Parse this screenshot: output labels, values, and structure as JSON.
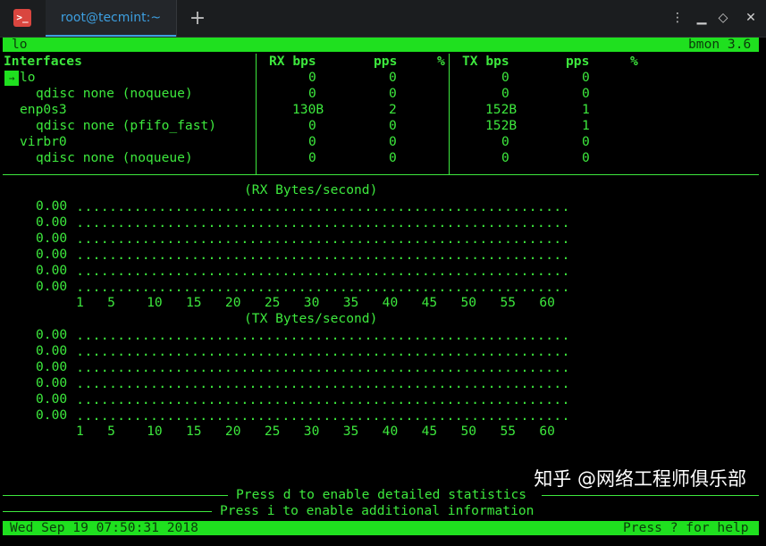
{
  "titlebar": {
    "app_icon": ">_",
    "tab_label": "root@tecmint:~",
    "new_tab": "+",
    "controls": {
      "menu": "⋮",
      "minimize": "▁",
      "restore": "◇",
      "maximize": "▢",
      "close": "✕"
    }
  },
  "top_bar": {
    "left": "lo",
    "right": "bmon 3.6"
  },
  "table": {
    "headers": {
      "interfaces": "Interfaces",
      "rx_bps": "RX bps",
      "rx_pps": "pps",
      "rx_pct": "%",
      "tx_bps": "TX bps",
      "tx_pps": "pps",
      "tx_pct": "%"
    },
    "rows": [
      {
        "name": "lo",
        "rx_bps": "0",
        "rx_pps": "0",
        "tx_bps": "0",
        "tx_pps": "0"
      },
      {
        "name": "qdisc none (noqueue)",
        "rx_bps": "0",
        "rx_pps": "0",
        "tx_bps": "0",
        "tx_pps": "0"
      },
      {
        "name": "enp0s3",
        "rx_bps": "130B",
        "rx_pps": "2",
        "tx_bps": "152B",
        "tx_pps": "1"
      },
      {
        "name": "qdisc none (pfifo_fast)",
        "rx_bps": "0",
        "rx_pps": "0",
        "tx_bps": "152B",
        "tx_pps": "1"
      },
      {
        "name": "virbr0",
        "rx_bps": "0",
        "rx_pps": "0",
        "tx_bps": "0",
        "tx_pps": "0"
      },
      {
        "name": "qdisc none (noqueue)",
        "rx_bps": "0",
        "rx_pps": "0",
        "tx_bps": "0",
        "tx_pps": "0"
      }
    ]
  },
  "graphs": {
    "rx": {
      "title": "(RX Bytes/second)",
      "y_labels": [
        "0.00",
        "0.00",
        "0.00",
        "0.00",
        "0.00",
        "0.00"
      ],
      "dots": "............................................................",
      "x_labels": "1   5    10   15   20   25   30   35   40   45   50   55   60"
    },
    "tx": {
      "title": "(TX Bytes/second)",
      "y_labels": [
        "0.00",
        "0.00",
        "0.00",
        "0.00",
        "0.00",
        "0.00"
      ],
      "dots": "............................................................",
      "x_labels": "1   5    10   15   20   25   30   35   40   45   50   55   60"
    }
  },
  "footer": {
    "hint_detailed": "Press d to enable detailed statistics",
    "hint_additional": "Press i to enable additional information",
    "datetime": "Wed Sep 19 07:50:31 2018",
    "help": "Press ? for help"
  },
  "watermark": "知乎 @网络工程师俱乐部",
  "colors": {
    "terminal_green": "#3de83d",
    "bar_green": "#1fe01f",
    "tab_accent": "#3d9fe0",
    "background": "#000000"
  }
}
